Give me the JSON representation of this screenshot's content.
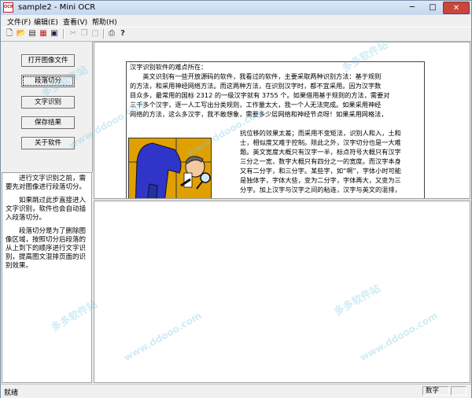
{
  "window": {
    "title": "sample2 - Mini OCR",
    "app_icon_text": "OCR",
    "min": "─",
    "max": "□",
    "close": "✕"
  },
  "menu": [
    "文件(F)",
    "编辑(E)",
    "查看(V)",
    "帮助(H)"
  ],
  "toolbar": {
    "icons": [
      "new-icon",
      "open-icon",
      "barcode-icon",
      "format-icon",
      "save-icon",
      "cut-icon",
      "copy-icon",
      "paste-icon",
      "print-icon",
      "help-icon"
    ],
    "glyphs": {
      "new": "🗋",
      "open": "📂",
      "barcode": "▤",
      "format": "▦",
      "save": "▣",
      "cut": "✂",
      "copy": "❐",
      "paste": "▢",
      "print": "⎙",
      "help": "?"
    }
  },
  "buttons": {
    "open_image": "打开图像文件",
    "segment": "段落切分",
    "recognize": "文字识别",
    "save": "保存结果",
    "about": "关于软件"
  },
  "help_text": [
    "进行文字识别之前，需要先对图像进行段落切分。",
    "如果跳过此步直接进入文字识别，软件也会自动插入段落切分。",
    "段落切分是为了删除图像区域，按照切分后段落的从上到下的顺序进行文字识别，提高图文混排页面的识别效果。"
  ],
  "document": {
    "title": "汉字识别软件的难点所在：",
    "lines": [
      "　　英文识别有一些开放源码的软件，我看过的软件，主要采取两种识别方法：基于规则",
      "的方法，和采用神经网络方法。而这两种方法，在识别汉字时，都不宜采用。因为汉字数",
      "目众多，最常用的国标 2312 的一级汉字就有 3755 个。如果借用基于规则的方法，需要对",
      "三千多个汉字，逐一人工写出分类规则，工作量太大，我一个人无法完成。如果采用神经",
      "网络的方法，这么多汉字，我不敢想象，需要多少层网络和神经节点呀！如果采用网格法，"
    ],
    "right_lines": [
      "抗位移的效果太差；而采用不变矩法，识别人和入，土和",
      "士，相似度又难于控制。除此之外，汉字切分也是一大难",
      "题。英文宽度大概只有汉字一半，标点符号大概只有汉字",
      "三分之一宽，数字大概只有四分之一的宽度。而汉字本身",
      "又有二分字，和三分字。某些字，如“啊”，字体小时可能",
      "是独体字，字体大些，变为二分字，字体再大，又变为三",
      "分字。加上汉字与汉字之间的粘连，汉字与英文的混排，"
    ]
  },
  "status": {
    "text": "就绪",
    "mode": "数字"
  },
  "watermark": {
    "text": "多多软件站",
    "url": "www.ddooo.com"
  }
}
